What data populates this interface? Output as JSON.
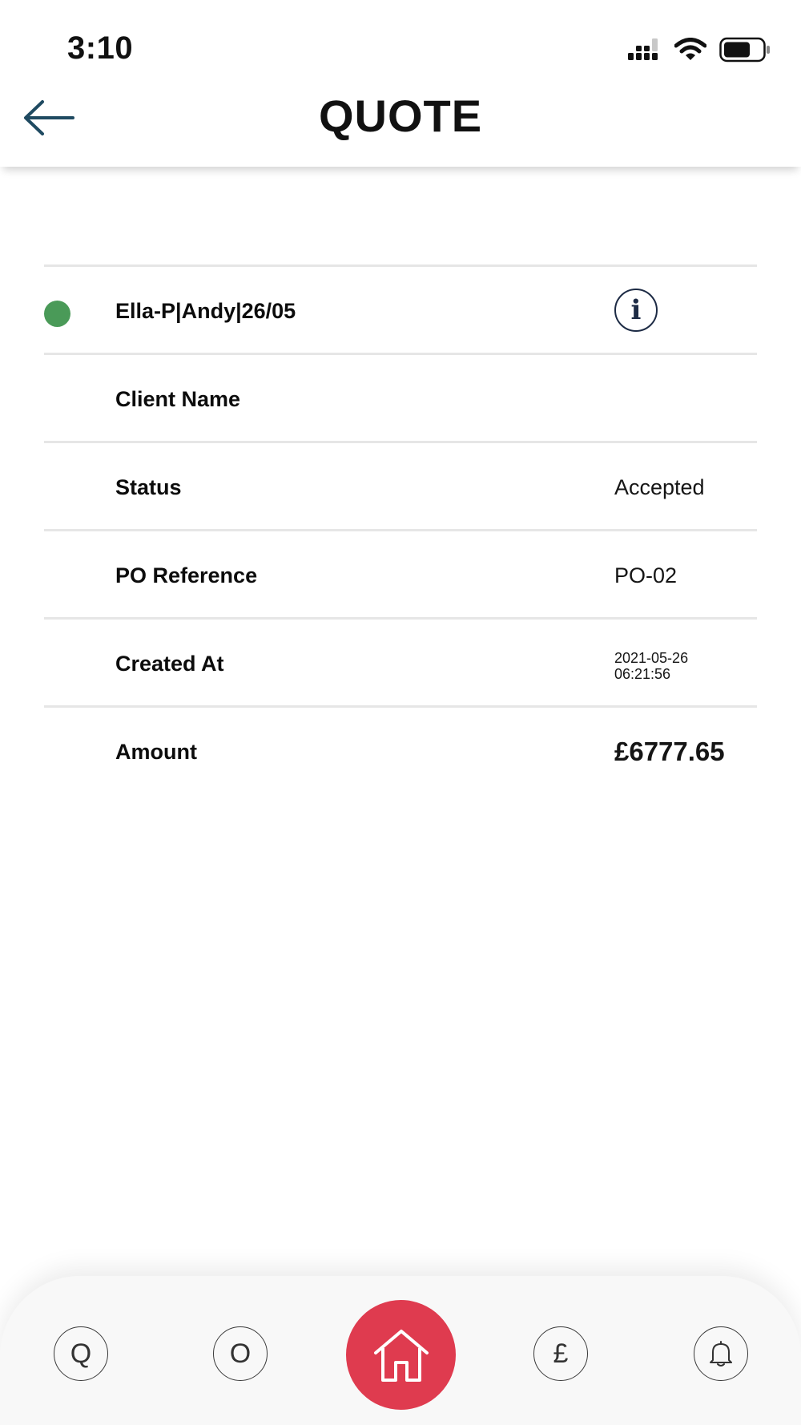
{
  "status_bar": {
    "time": "3:10"
  },
  "header": {
    "title": "QUOTE"
  },
  "quote": {
    "name": "Ella-P|Andy|26/05",
    "status_dot_color": "#4a9a58",
    "info_glyph": "i",
    "rows": [
      {
        "label": "Client Name",
        "value": ""
      },
      {
        "label": "Status",
        "value": "Accepted"
      },
      {
        "label": "PO Reference",
        "value": "PO-02"
      },
      {
        "label": "Created At",
        "value_line1": "2021-05-26",
        "value_line2": "06:21:56"
      },
      {
        "label": "Amount",
        "value": "£6777.65"
      }
    ]
  },
  "bottom_nav": {
    "items": [
      {
        "glyph": "Q",
        "icon": "q-icon"
      },
      {
        "glyph": "O",
        "icon": "o-icon"
      },
      {
        "glyph": "",
        "icon": "home-icon"
      },
      {
        "glyph": "£",
        "icon": "pound-icon"
      },
      {
        "glyph": "",
        "icon": "bell-icon"
      }
    ],
    "accent_color": "#df3b4f"
  }
}
